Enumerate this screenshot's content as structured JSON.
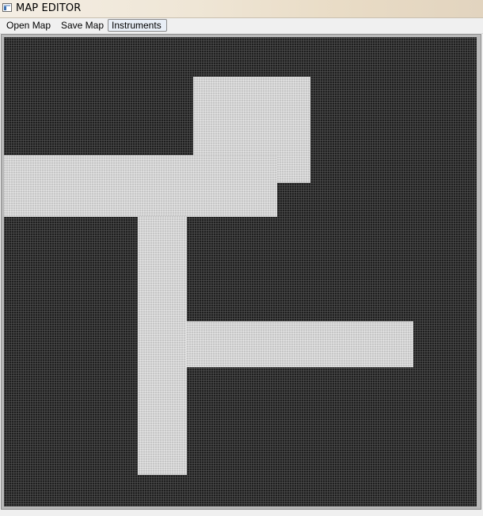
{
  "window": {
    "title": "MAP EDITOR",
    "icon": "window-app-icon"
  },
  "menu": {
    "items": [
      {
        "label": "Open Map"
      },
      {
        "label": "Save Map"
      },
      {
        "label": "Instruments",
        "active": true
      }
    ]
  },
  "map": {
    "colors": {
      "wall": "#1f1f1f",
      "floor": "#c6c6c6",
      "frame": "#b9b9b9"
    }
  }
}
